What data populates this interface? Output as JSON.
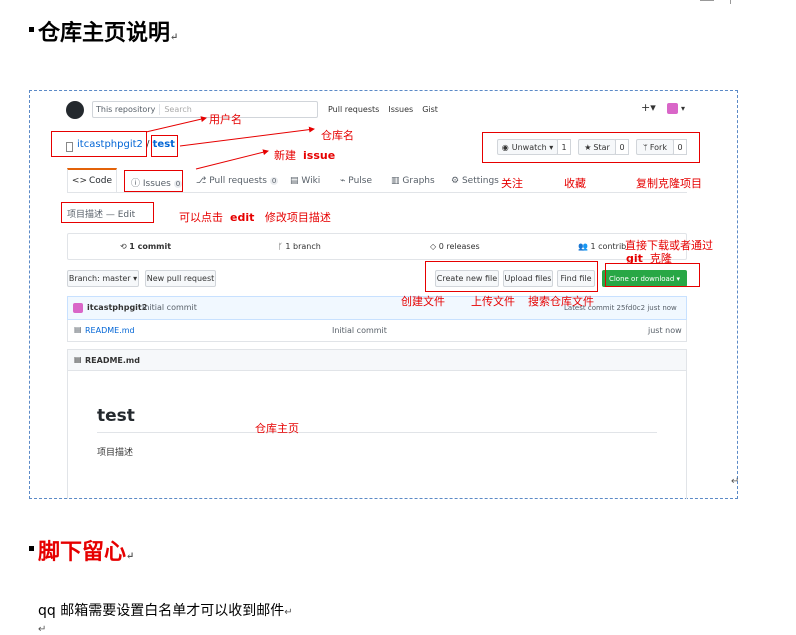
{
  "doc": {
    "heading1": "仓库主页说明",
    "heading2": "脚下留心",
    "body": "qq 邮箱需要设置白名单才可以收到邮件",
    "para_mark": "↵"
  },
  "github": {
    "search_scope": "This repository",
    "search_placeholder": "Search",
    "nav": [
      "Pull requests",
      "Issues",
      "Gist"
    ],
    "plus_label": "+▾",
    "avatar_caret": "▾",
    "owner": "itcastphpgit2",
    "separator": "/",
    "repo": "test",
    "watch_label": "Unwatch ▾",
    "watch_count": "1",
    "star_label": "Star",
    "star_count": "0",
    "fork_label": "Fork",
    "fork_count": "0",
    "tabs": [
      {
        "label": "Code"
      },
      {
        "label": "Issues",
        "count": "0"
      },
      {
        "label": "Pull requests",
        "count": "0"
      },
      {
        "label": "Wiki"
      },
      {
        "label": "Pulse"
      },
      {
        "label": "Graphs"
      },
      {
        "label": "Settings"
      }
    ],
    "description": "项目描述 — Edit",
    "summary": {
      "commits": "1 commit",
      "branches": "1 branch",
      "releases": "0 releases",
      "contributors": "1 contrib"
    },
    "branch_label": "Branch: master ▾",
    "new_pr_label": "New pull request",
    "create_file_label": "Create new file",
    "upload_label": "Upload files",
    "find_file_label": "Find file",
    "clone_label": "Clone or download ▾",
    "commit_author": "itcastphpgit2",
    "commit_message": "Initial commit",
    "latest_commit": "Latest commit 25fd0c2  just now",
    "file_name": "README.md",
    "file_message": "Initial commit",
    "file_time": "just now",
    "readme_header": "README.md",
    "readme_title": "test",
    "readme_desc": "项目描述"
  },
  "annotations": {
    "username": "用户名",
    "reponame": "仓库名",
    "new_issue_a": "新建",
    "new_issue_b": "issue",
    "watch": "关注",
    "star": "收藏",
    "fork": "复制克隆项目",
    "edit_a": "可以点击",
    "edit_b": "edit",
    "edit_c": "修改项目描述",
    "clone_1": "直接下载或者通过",
    "clone_2a": "git",
    "clone_2b": "克隆",
    "create": "创建文件",
    "upload": "上传文件",
    "search": "搜索仓库文件",
    "home": "仓库主页"
  },
  "colors": {
    "annotation": "#e60000",
    "link": "#0366d6",
    "clone_button": "#28a745",
    "screenshot_border": "#5b8ac7"
  }
}
